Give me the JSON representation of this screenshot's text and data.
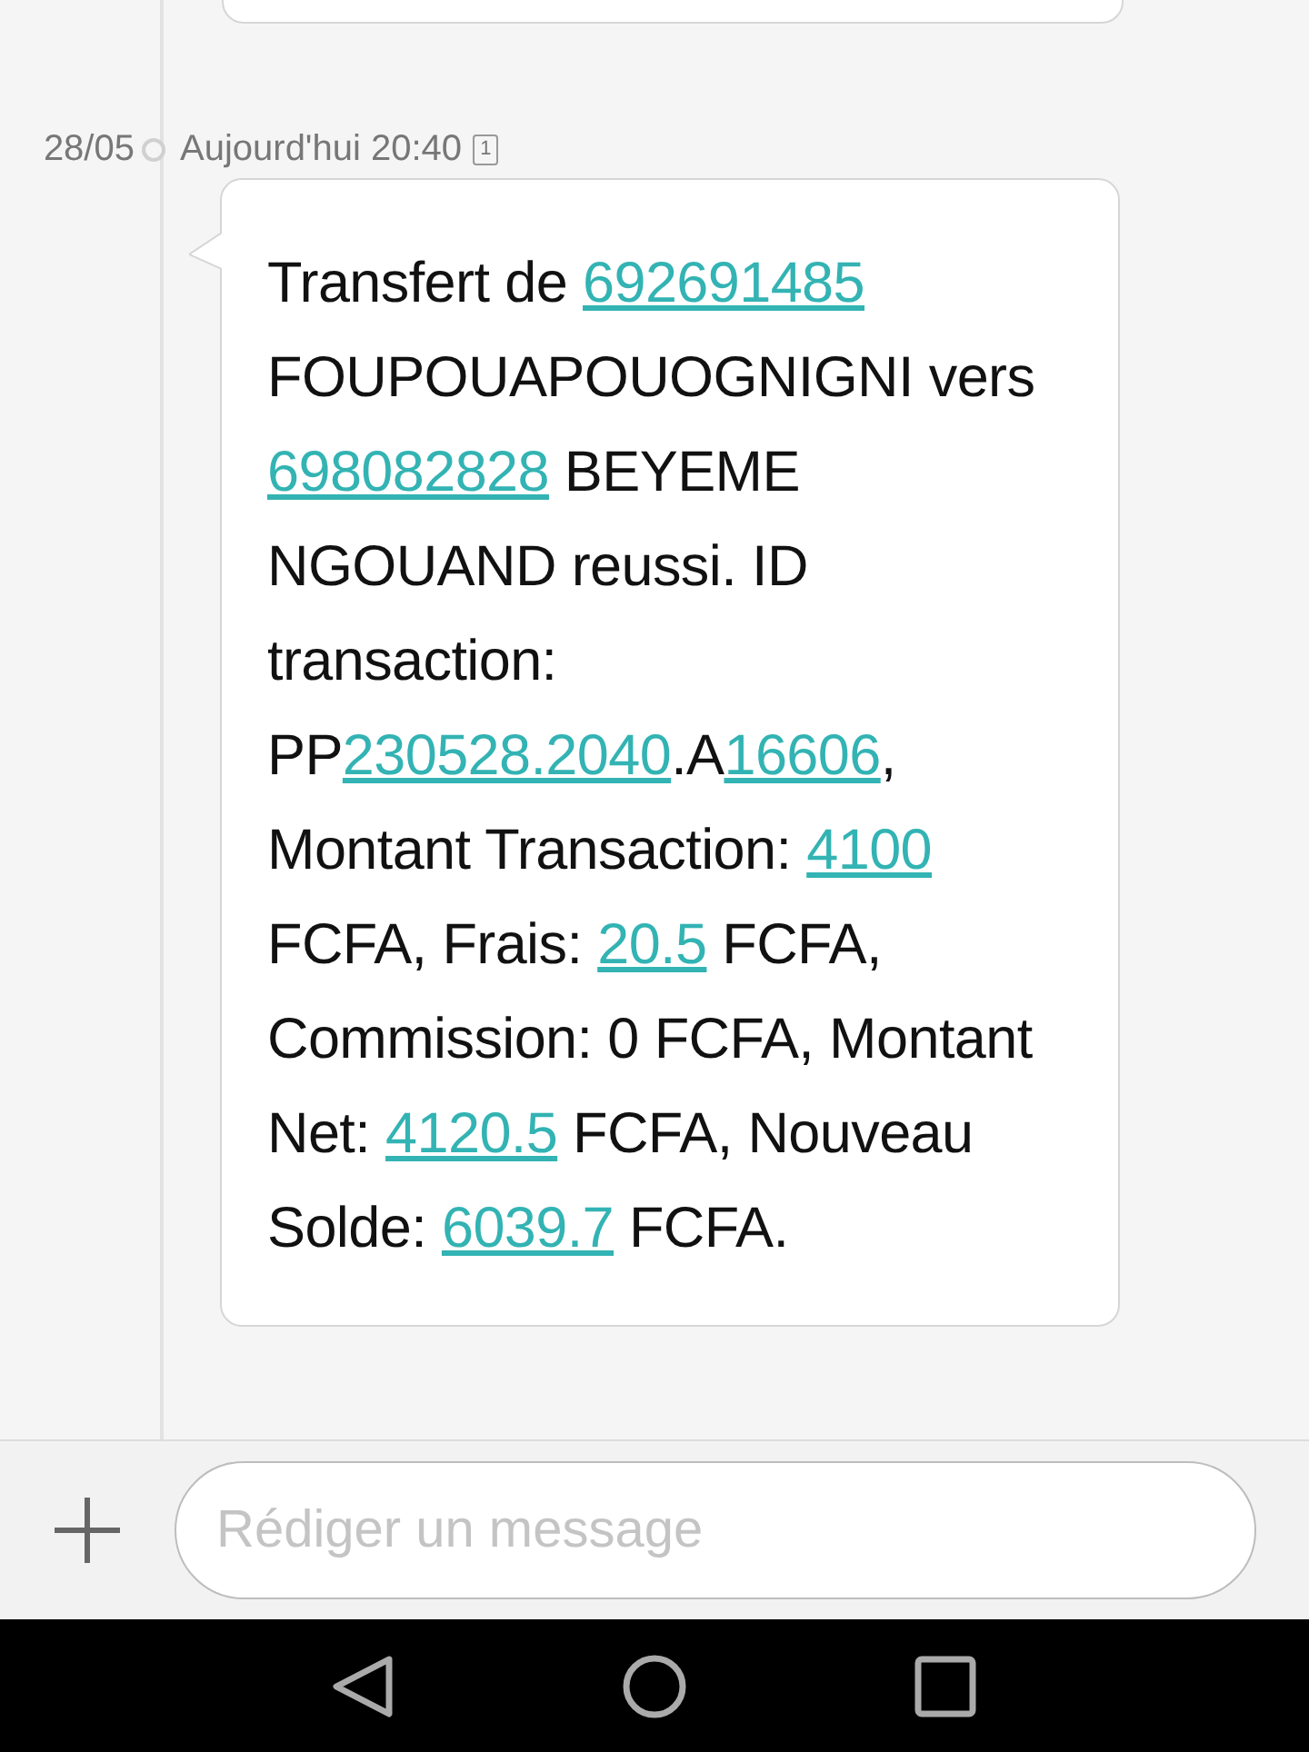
{
  "date_group": {
    "date": "28/05",
    "time": "Aujourd'hui 20:40",
    "sim": "1"
  },
  "message": {
    "segments": [
      {
        "kind": "plain",
        "text": "Transfert de "
      },
      {
        "kind": "link",
        "text": "692691485"
      },
      {
        "kind": "plain",
        "text": " FOUPOUAPOUOGNIGNI vers "
      },
      {
        "kind": "link",
        "text": "698082828"
      },
      {
        "kind": "plain",
        "text": " BEYEME NGOUAND reussi. ID transaction: PP"
      },
      {
        "kind": "link",
        "text": "230528.2040"
      },
      {
        "kind": "plain",
        "text": ".A"
      },
      {
        "kind": "link",
        "text": "16606"
      },
      {
        "kind": "plain",
        "text": ", Montant Transaction: "
      },
      {
        "kind": "link",
        "text": "4100"
      },
      {
        "kind": "plain",
        "text": " FCFA, Frais: "
      },
      {
        "kind": "link",
        "text": "20.5"
      },
      {
        "kind": "plain",
        "text": " FCFA, Commission: 0 FCFA, Montant Net: "
      },
      {
        "kind": "link",
        "text": "4120.5"
      },
      {
        "kind": "plain",
        "text": " FCFA, Nouveau Solde: "
      },
      {
        "kind": "link",
        "text": "6039.7"
      },
      {
        "kind": "plain",
        "text": " FCFA."
      }
    ]
  },
  "composer": {
    "placeholder": "Rédiger un message"
  }
}
